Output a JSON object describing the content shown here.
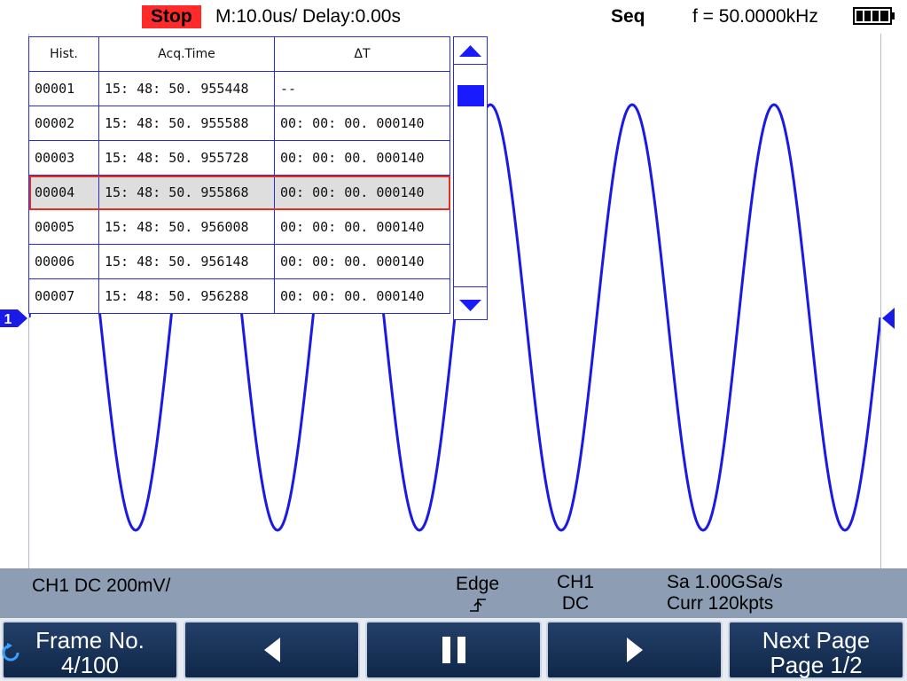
{
  "topbar": {
    "state": "Stop",
    "timebase": "M:10.0us/ Delay:0.00s",
    "mode": "Seq",
    "frequency": "f = 50.0000kHz",
    "icons": {
      "battery": "battery-full-icon"
    }
  },
  "history": {
    "headers": [
      "Hist.",
      "Acq.Time",
      "ΔT"
    ],
    "rows": [
      [
        "00001",
        "15: 48: 50. 955448",
        "--"
      ],
      [
        "00002",
        "15: 48: 50. 955588",
        "00: 00: 00. 000140"
      ],
      [
        "00003",
        "15: 48: 50. 955728",
        "00: 00: 00. 000140"
      ],
      [
        "00004",
        "15: 48: 50. 955868",
        "00: 00: 00. 000140"
      ],
      [
        "00005",
        "15: 48: 50. 956008",
        "00: 00: 00. 000140"
      ],
      [
        "00006",
        "15: 48: 50. 956148",
        "00: 00: 00. 000140"
      ],
      [
        "00007",
        "15: 48: 50. 956288",
        "00: 00: 00. 000140"
      ]
    ],
    "selected_row": 3,
    "scroll_position": 0.1
  },
  "channel_marker": "1",
  "infobar": {
    "ch1": "CH1 DC 200mV/",
    "trigger_type": "Edge",
    "trigger_source": "CH1",
    "trigger_coupling": "DC",
    "sample_rate": "Sa 1.00GSa/s",
    "memory": "Curr 120kpts"
  },
  "softkeys": {
    "frame_label": "Frame No.",
    "frame_value": "4/100",
    "next_page_label": "Next Page",
    "page_value": "Page 1/2"
  },
  "colors": {
    "waveform": "#1a1ae6",
    "table_border": "#2a2ae0",
    "stop_badge": "#ff2a2a",
    "selected_outline": "#e03020",
    "infobar_bg": "#8d9db3",
    "softkey_bg": "#1a3358"
  }
}
